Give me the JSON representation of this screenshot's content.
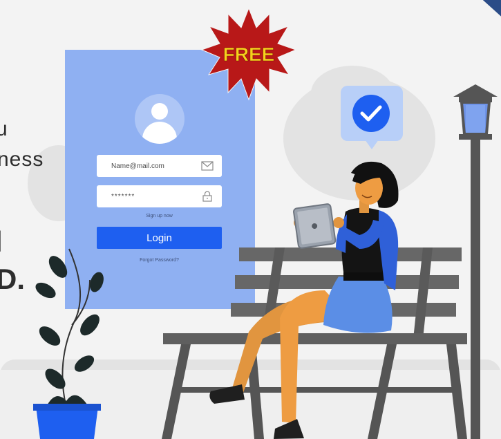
{
  "headline": {
    "line1": "u",
    "line2": "ness",
    "line3": "l",
    "line4": "D."
  },
  "badge": {
    "text": "FREE",
    "color": "#b81818",
    "text_color": "#f5d21c"
  },
  "login_form": {
    "email_value": "Name@mail.com",
    "password_value": "*******",
    "signup_link": "Sign up now",
    "login_button": "Login",
    "forgot_link": "Forgot Password?",
    "email_icon": "envelope-icon",
    "password_icon": "lock-icon",
    "avatar_icon": "user-icon"
  },
  "colors": {
    "card": "#8fb0f2",
    "button": "#1e5ff0",
    "check": "#1e5ff0",
    "bench": "#676767",
    "shirt": "#2f60d8",
    "skirt": "#5b8ee6"
  }
}
